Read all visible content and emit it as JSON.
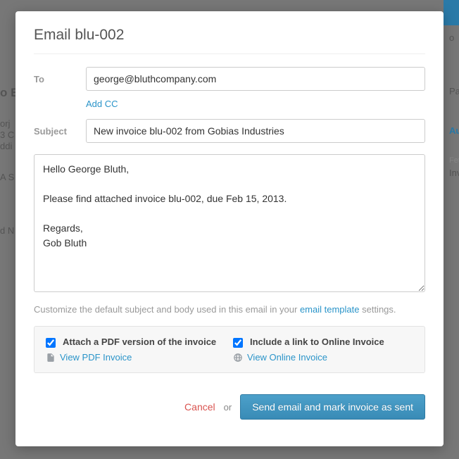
{
  "modal": {
    "title": "Email blu-002",
    "labels": {
      "to": "To",
      "subject": "Subject"
    },
    "fields": {
      "to": "george@bluthcompany.com",
      "subject": "New invoice blu-002 from Gobias Industries",
      "body": "Hello George Bluth,\n\nPlease find attached invoice blu-002, due Feb 15, 2013.\n\nRegards,\nGob Bluth"
    },
    "add_cc": "Add CC",
    "hint_pre": "Customize the default subject and body used in this email in your ",
    "hint_link": "email template",
    "hint_post": " settings.",
    "attach": {
      "pdf": {
        "label": "Attach a PDF version of the invoice",
        "view": "View PDF Invoice",
        "checked": true
      },
      "online": {
        "label": "Include a link to Online Invoice",
        "view": "View Online Invoice",
        "checked": true
      }
    },
    "footer": {
      "cancel": "Cancel",
      "or": "or",
      "send": "Send email and mark invoice as sent"
    }
  },
  "background": {
    "f1": "o B",
    "f2": "orj",
    "f3": "3 C",
    "f4": "ddi",
    "f5": "A S",
    "f6": "d N",
    "f7": "o",
    "f8": "Pa",
    "f9": "Au",
    "f10": "Fet",
    "f11": "Inv"
  }
}
